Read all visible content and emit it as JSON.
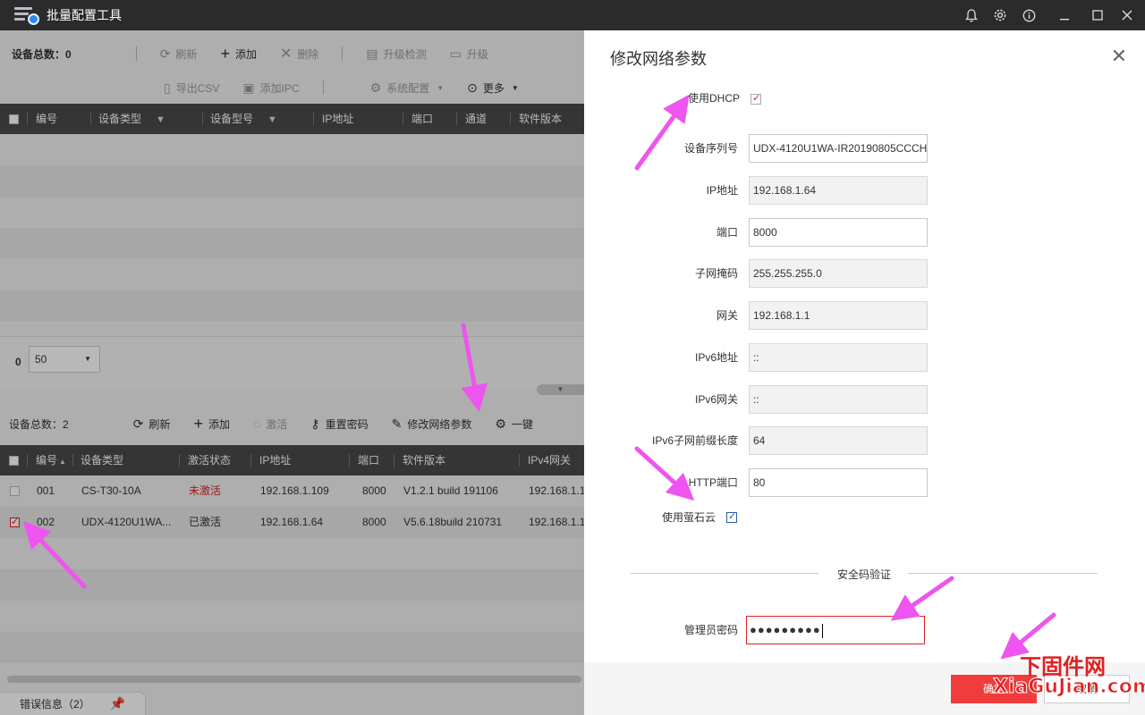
{
  "app": {
    "title": "批量配置工具"
  },
  "top_panel": {
    "device_count": "设备总数：0",
    "toolbar": [
      "刷新",
      "添加",
      "删除",
      "升级检测",
      "升级"
    ],
    "toolbar2": [
      "导出CSV",
      "添加IPC",
      "系统配置",
      "更多"
    ],
    "columns": [
      "编号",
      "设备类型",
      "设备型号",
      "IP地址",
      "端口",
      "通道",
      "软件版本"
    ],
    "page_index": "0",
    "page_size": "50"
  },
  "bottom_panel": {
    "device_count": "设备总数：2",
    "toolbar": [
      "刷新",
      "添加",
      "激活",
      "重置密码",
      "修改网络参数",
      "一键"
    ],
    "columns": [
      "编号",
      "设备类型",
      "激活状态",
      "IP地址",
      "端口",
      "软件版本",
      "IPv4网关"
    ],
    "rows": [
      {
        "no": "001",
        "type": "CS-T30-10A",
        "status": "未激活",
        "ip": "192.168.1.109",
        "port": "8000",
        "version": "V1.2.1 build 191106",
        "gateway": "192.168.1.1",
        "checked": false
      },
      {
        "no": "002",
        "type": "UDX-4120U1WA...",
        "status": "已激活",
        "ip": "192.168.1.64",
        "port": "8000",
        "version": "V5.6.18build 210731",
        "gateway": "192.168.1.1",
        "checked": true
      }
    ]
  },
  "error_tab": {
    "label": "错误信息（2）"
  },
  "dialog": {
    "title": "修改网络参数",
    "use_dhcp_label": "使用DHCP",
    "fields": [
      {
        "label": "设备序列号",
        "value": "UDX-4120U1WA-IR20190805CCCH",
        "editable": true
      },
      {
        "label": "IP地址",
        "value": "192.168.1.64",
        "editable": false
      },
      {
        "label": "端口",
        "value": "8000",
        "editable": true
      },
      {
        "label": "子网掩码",
        "value": "255.255.255.0",
        "editable": false
      },
      {
        "label": "网关",
        "value": "192.168.1.1",
        "editable": false
      },
      {
        "label": "IPv6地址",
        "value": "::",
        "editable": false
      },
      {
        "label": "IPv6网关",
        "value": "::",
        "editable": false
      },
      {
        "label": "IPv6子网前缀长度",
        "value": "64",
        "editable": false
      },
      {
        "label": "HTTP端口",
        "value": "80",
        "editable": true
      }
    ],
    "use_ezviz_label": "使用萤石云",
    "security_section": "安全码验证",
    "admin_password_label": "管理员密码",
    "admin_password_value": "●●●●●●●●●",
    "ok_label": "确定",
    "cancel_label": "取消"
  },
  "watermark": {
    "cn": "下固件网",
    "en": "XiaGuJian.com"
  },
  "colors": {
    "accent": "#f03c3c",
    "header": "#4a4a4a",
    "titlebar": "#2b2b2b",
    "arrow": "#ee55ee"
  }
}
